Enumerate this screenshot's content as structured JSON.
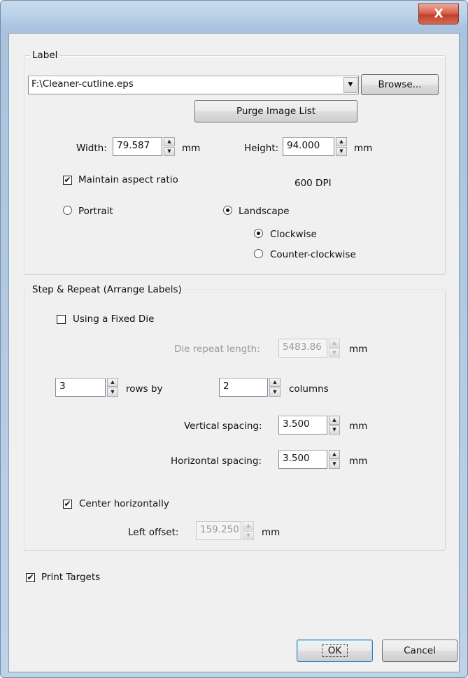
{
  "titlebar": {
    "close_glyph": "X"
  },
  "label_group": {
    "title": "Label",
    "file_path": "F:\\Cleaner-cutline.eps",
    "browse_label": "Browse...",
    "purge_label": "Purge Image List",
    "width_label": "Width:",
    "width_value": "79.587",
    "width_unit": "mm",
    "height_label": "Height:",
    "height_value": "94.000",
    "height_unit": "mm",
    "maintain_aspect_label": "Maintain aspect ratio",
    "maintain_aspect_checked": true,
    "dpi_text": "600 DPI",
    "portrait_label": "Portrait",
    "landscape_label": "Landscape",
    "clockwise_label": "Clockwise",
    "counter_clockwise_label": "Counter-clockwise",
    "orientation": "Landscape",
    "rotation": "Clockwise"
  },
  "step_group": {
    "title": "Step & Repeat (Arrange Labels)",
    "fixed_die_label": "Using a Fixed Die",
    "fixed_die_checked": false,
    "die_repeat_label": "Die repeat length:",
    "die_repeat_value": "5483.86",
    "die_repeat_unit": "mm",
    "rows_value": "3",
    "rows_label": "rows by",
    "columns_value": "2",
    "columns_label": "columns",
    "vertical_label": "Vertical spacing:",
    "vertical_value": "3.500",
    "vertical_unit": "mm",
    "horizontal_label": "Horizontal spacing:",
    "horizontal_value": "3.500",
    "horizontal_unit": "mm",
    "center_label": "Center horizontally",
    "center_checked": true,
    "left_offset_label": "Left offset:",
    "left_offset_value": "159.250",
    "left_offset_unit": "mm"
  },
  "print_targets_label": "Print Targets",
  "print_targets_checked": true,
  "buttons": {
    "ok": "OK",
    "cancel": "Cancel"
  },
  "glyphs": {
    "check": "✔",
    "spin_up": "▲",
    "spin_down": "▼",
    "combo_arrow": "▼"
  },
  "icons": [
    "close-icon",
    "dropdown-arrow-icon",
    "spin-up-icon",
    "spin-down-icon",
    "checkmark-icon"
  ]
}
